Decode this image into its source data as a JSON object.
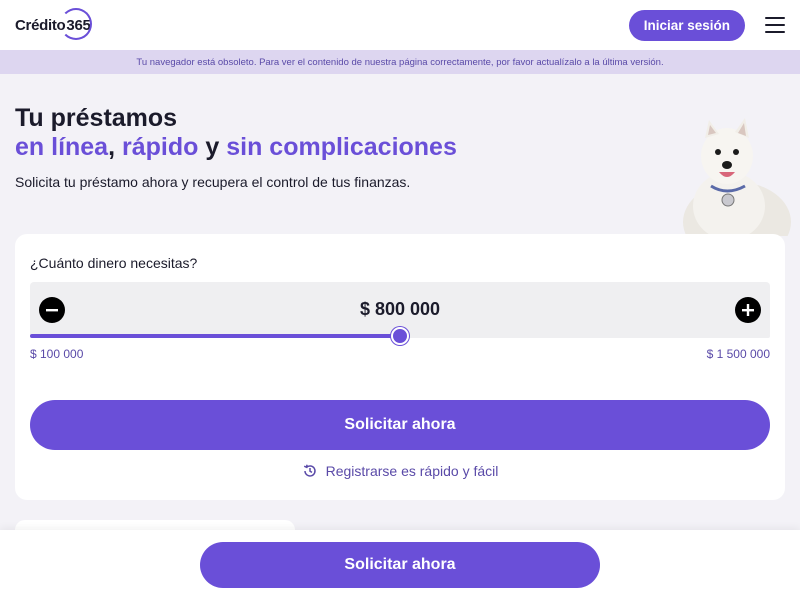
{
  "header": {
    "logo_word": "Crédito",
    "logo_number": "365",
    "login_label": "Iniciar sesión",
    "menu_icon": "hamburger-menu-icon"
  },
  "banner": {
    "text": "Tu navegador está obsoleto. Para ver el contenido de nuestra página correctamente, por favor actualízalo a la última versión."
  },
  "hero": {
    "title_line1": "Tu préstamos",
    "accent_1": "en línea",
    "sep_1": ",",
    "accent_2": "rápido",
    "conj": "y",
    "accent_3": "sin complicaciones",
    "subtitle": "Solicita tu préstamo ahora y recupera el control de tus finanzas."
  },
  "calculator": {
    "question": "¿Cuánto dinero necesitas?",
    "amount_display": "$ 800 000",
    "min_label": "$ 100 000",
    "max_label": "$ 1 500 000",
    "amount_value": 800000,
    "min_value": 100000,
    "max_value": 1500000,
    "cta_label": "Solicitar ahora",
    "register_label": "Registrarse es rápido y fácil",
    "register_icon": "history-clock-icon"
  },
  "footer": {
    "cta_label": "Solicitar ahora"
  },
  "colors": {
    "accent": "#6a4fd8",
    "banner_bg": "#ddd6f0",
    "page_bg": "#f3f2f7"
  }
}
